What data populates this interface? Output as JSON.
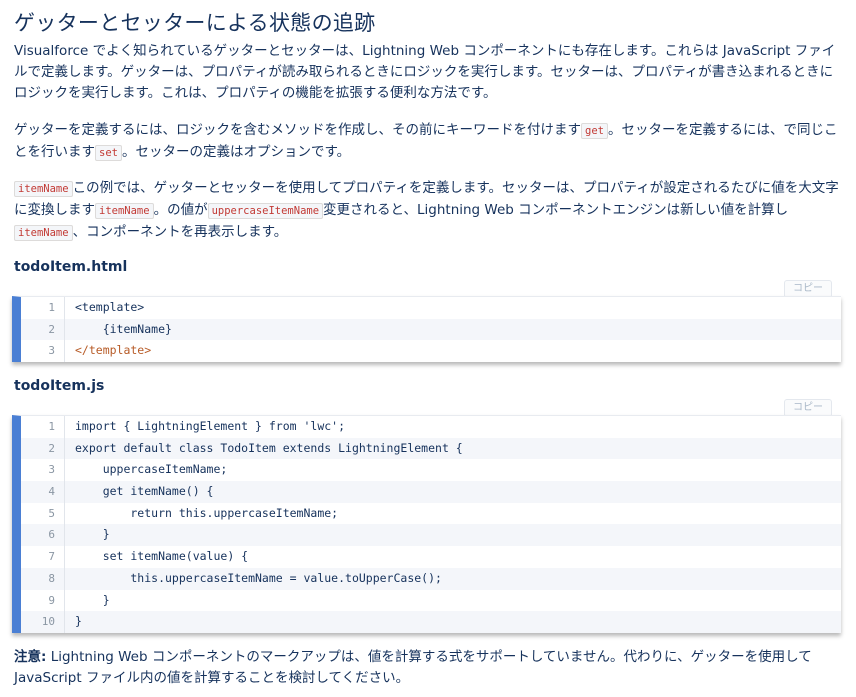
{
  "heading": "ゲッターとセッターによる状態の追跡",
  "intro": "Visualforce でよく知られているゲッターとセッターは、Lightning Web コンポーネントにも存在します。これらは JavaScript ファイルで定義します。ゲッターは、プロパティが読み取られるときにロジックを実行します。セッターは、プロパティが書き込まれるときにロジックを実行します。これは、プロパティの機能を拡張する便利な方法です。",
  "p2": {
    "text_a": "ゲッターを定義するには、ロジックを含むメソッドを作成し、その前にキーワードを付けます",
    "code_get": "get",
    "text_b": "。セッターを定義するには、で同じことを行います",
    "code_set": "set",
    "text_c": "。セッターの定義はオプションです。"
  },
  "p3": {
    "code_1": "itemName",
    "text_a": "この例では、ゲッターとセッターを使用してプロパティを定義します。セッターは、プロパティが設定されるたびに値を大文字に変換します",
    "code_2": "itemName",
    "text_b": "。の値が",
    "code_3": "uppercaseItemName",
    "text_c": "変更されると、Lightning Web コンポーネントエンジンは新しい値を計算し",
    "code_4": "itemName",
    "text_d": "、コンポーネントを再表示します。"
  },
  "copy_label": "コピー",
  "file1": {
    "title": "todoItem.html",
    "line_numbers": [
      "1",
      "2",
      "3"
    ],
    "lines": [
      "<template>",
      "    {itemName}",
      "</template>"
    ]
  },
  "file2": {
    "title": "todoItem.js",
    "line_numbers": [
      "1",
      "2",
      "3",
      "4",
      "5",
      "6",
      "7",
      "8",
      "9",
      "10"
    ],
    "lines": [
      "import { LightningElement } from 'lwc';",
      "export default class TodoItem extends LightningElement {",
      "    uppercaseItemName;",
      "    get itemName() {",
      "        return this.uppercaseItemName;",
      "    }",
      "    set itemName(value) {",
      "        this.uppercaseItemName = value.toUpperCase();",
      "    }",
      "}"
    ]
  },
  "note": {
    "label": "注意:",
    "text": " Lightning Web コンポーネントのマークアップは、値を計算する式をサポートしていません。代わりに、ゲッターを使用して JavaScript ファイル内の値を計算することを検討してください。"
  },
  "colors": {
    "text": "#16325c",
    "code_accent": "#c23934",
    "block_bar": "#4a7fd4",
    "keyword": "#2c6fc0",
    "function": "#1a6b2a"
  }
}
